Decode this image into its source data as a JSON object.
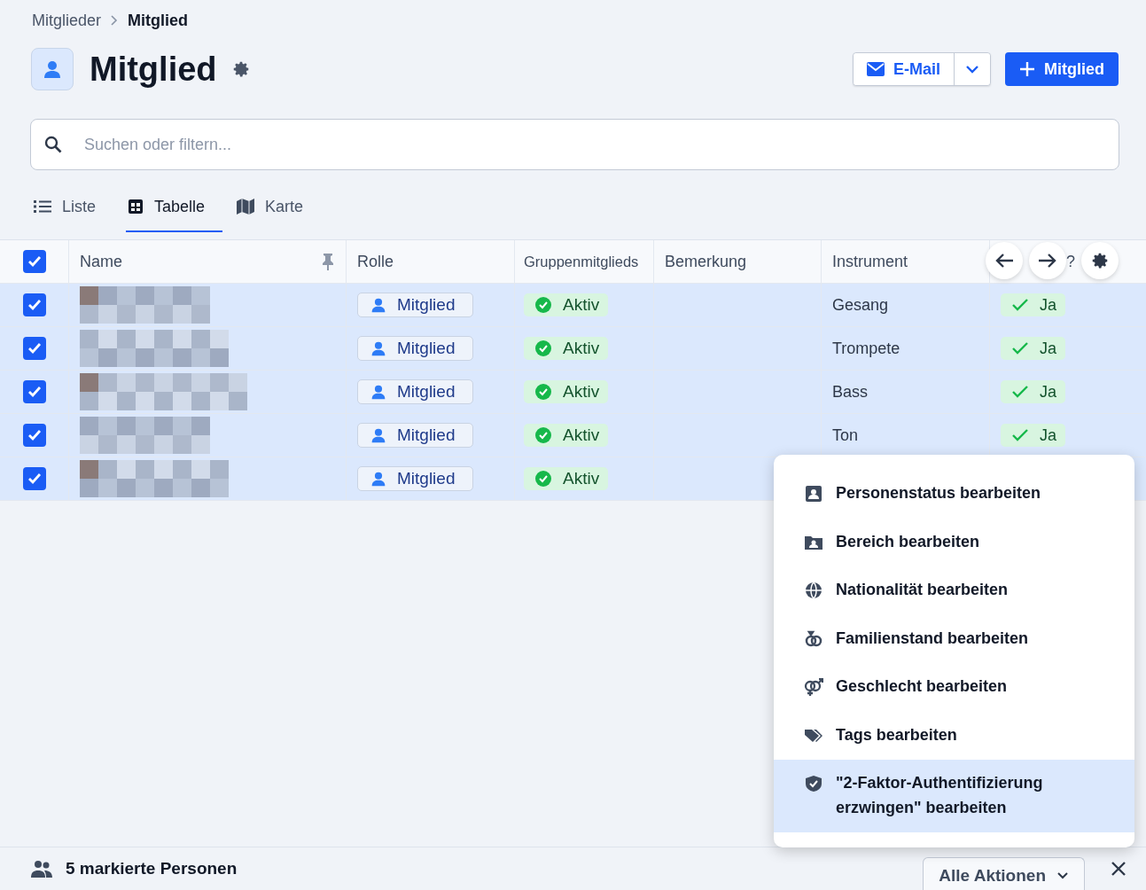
{
  "breadcrumb": [
    {
      "label": "Mitglieder"
    },
    {
      "label": "Mitglied"
    }
  ],
  "title": "Mitglied",
  "buttons": {
    "email": "E-Mail",
    "add": "Mitglied"
  },
  "search": {
    "placeholder": "Suchen oder filtern..."
  },
  "view_tabs": [
    {
      "label": "Liste",
      "selected": false
    },
    {
      "label": "Tabelle",
      "selected": true
    },
    {
      "label": "Karte",
      "selected": false
    }
  ],
  "table": {
    "all_checked": true,
    "columns": [
      {
        "label": "Name"
      },
      {
        "label": "Rolle"
      },
      {
        "label": "Gruppenmitglieds"
      },
      {
        "label": "Bemerkung"
      },
      {
        "label": "Instrument"
      },
      {
        "label": "?"
      }
    ],
    "rows": [
      {
        "checked": true,
        "role": "Mitglied",
        "status": "Aktiv",
        "instrument": "Gesang",
        "column_6": "Ja"
      },
      {
        "checked": true,
        "role": "Mitglied",
        "status": "Aktiv",
        "instrument": "Trompete",
        "column_6": "Ja"
      },
      {
        "checked": true,
        "role": "Mitglied",
        "status": "Aktiv",
        "instrument": "Bass",
        "column_6": "Ja"
      },
      {
        "checked": true,
        "role": "Mitglied",
        "status": "Aktiv",
        "instrument": "Ton",
        "column_6": "Ja"
      },
      {
        "checked": true,
        "role": "Mitglied",
        "status": "Aktiv"
      }
    ]
  },
  "action_menu": [
    {
      "label": "Personenstatus bearbeiten",
      "selected": false
    },
    {
      "label": "Bereich bearbeiten",
      "selected": false
    },
    {
      "label": "Nationalität bearbeiten",
      "selected": false
    },
    {
      "label": "Familienstand bearbeiten",
      "selected": false
    },
    {
      "label": "Geschlecht bearbeiten",
      "selected": false
    },
    {
      "label": "Tags bearbeiten",
      "selected": false
    },
    {
      "label": "\"2-Faktor-Authentifizierung erzwingen\" bearbeiten",
      "selected": true
    }
  ],
  "footer": {
    "selection": "5 markierte Personen",
    "actions": "Alle Aktionen"
  }
}
